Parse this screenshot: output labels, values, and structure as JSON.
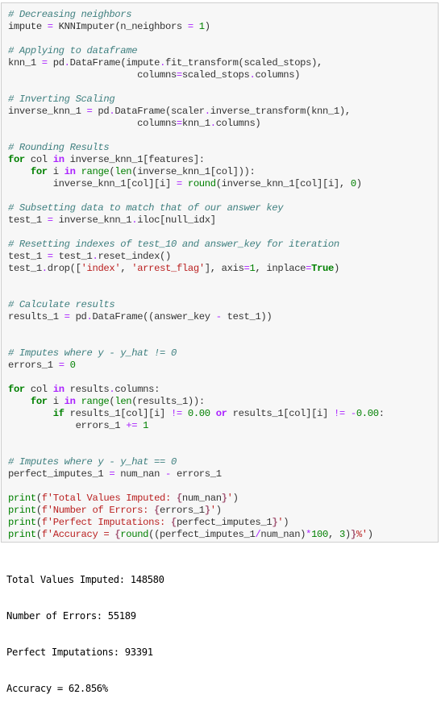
{
  "cell": {
    "lines": [
      [
        {
          "t": "c",
          "v": "# Decreasing neighbors"
        }
      ],
      [
        {
          "t": "n",
          "v": "impute "
        },
        {
          "t": "o",
          "v": "="
        },
        {
          "t": "n",
          "v": " KNNImputer(n_neighbors "
        },
        {
          "t": "o",
          "v": "="
        },
        {
          "t": "n",
          "v": " "
        },
        {
          "t": "m",
          "v": "1"
        },
        {
          "t": "n",
          "v": ")"
        }
      ],
      [],
      [
        {
          "t": "c",
          "v": "# Applying to dataframe"
        }
      ],
      [
        {
          "t": "n",
          "v": "knn_1 "
        },
        {
          "t": "o",
          "v": "="
        },
        {
          "t": "n",
          "v": " pd"
        },
        {
          "t": "o",
          "v": "."
        },
        {
          "t": "n",
          "v": "DataFrame(impute"
        },
        {
          "t": "o",
          "v": "."
        },
        {
          "t": "n",
          "v": "fit_transform(scaled_stops),"
        }
      ],
      [
        {
          "t": "n",
          "v": "                       columns"
        },
        {
          "t": "o",
          "v": "="
        },
        {
          "t": "n",
          "v": "scaled_stops"
        },
        {
          "t": "o",
          "v": "."
        },
        {
          "t": "n",
          "v": "columns)"
        }
      ],
      [],
      [
        {
          "t": "c",
          "v": "# Inverting Scaling"
        }
      ],
      [
        {
          "t": "n",
          "v": "inverse_knn_1 "
        },
        {
          "t": "o",
          "v": "="
        },
        {
          "t": "n",
          "v": " pd"
        },
        {
          "t": "o",
          "v": "."
        },
        {
          "t": "n",
          "v": "DataFrame(scaler"
        },
        {
          "t": "o",
          "v": "."
        },
        {
          "t": "n",
          "v": "inverse_transform(knn_1),"
        }
      ],
      [
        {
          "t": "n",
          "v": "                       columns"
        },
        {
          "t": "o",
          "v": "="
        },
        {
          "t": "n",
          "v": "knn_1"
        },
        {
          "t": "o",
          "v": "."
        },
        {
          "t": "n",
          "v": "columns)"
        }
      ],
      [],
      [
        {
          "t": "c",
          "v": "# Rounding Results"
        }
      ],
      [
        {
          "t": "k",
          "v": "for"
        },
        {
          "t": "n",
          "v": " col "
        },
        {
          "t": "ow",
          "v": "in"
        },
        {
          "t": "n",
          "v": " inverse_knn_1[features]:"
        }
      ],
      [
        {
          "t": "n",
          "v": "    "
        },
        {
          "t": "k",
          "v": "for"
        },
        {
          "t": "n",
          "v": " i "
        },
        {
          "t": "ow",
          "v": "in"
        },
        {
          "t": "n",
          "v": " "
        },
        {
          "t": "b",
          "v": "range"
        },
        {
          "t": "n",
          "v": "("
        },
        {
          "t": "b",
          "v": "len"
        },
        {
          "t": "n",
          "v": "(inverse_knn_1[col])):"
        }
      ],
      [
        {
          "t": "n",
          "v": "        inverse_knn_1[col][i] "
        },
        {
          "t": "o",
          "v": "="
        },
        {
          "t": "n",
          "v": " "
        },
        {
          "t": "b",
          "v": "round"
        },
        {
          "t": "n",
          "v": "(inverse_knn_1[col][i], "
        },
        {
          "t": "m",
          "v": "0"
        },
        {
          "t": "n",
          "v": ")"
        }
      ],
      [],
      [
        {
          "t": "c",
          "v": "# Subsetting data to match that of our answer key"
        }
      ],
      [
        {
          "t": "n",
          "v": "test_1 "
        },
        {
          "t": "o",
          "v": "="
        },
        {
          "t": "n",
          "v": " inverse_knn_1"
        },
        {
          "t": "o",
          "v": "."
        },
        {
          "t": "n",
          "v": "iloc[null_idx]"
        }
      ],
      [],
      [
        {
          "t": "c",
          "v": "# Resetting indexes of test_10 and answer_key for iteration"
        }
      ],
      [
        {
          "t": "n",
          "v": "test_1 "
        },
        {
          "t": "o",
          "v": "="
        },
        {
          "t": "n",
          "v": " test_1"
        },
        {
          "t": "o",
          "v": "."
        },
        {
          "t": "n",
          "v": "reset_index()"
        }
      ],
      [
        {
          "t": "n",
          "v": "test_1"
        },
        {
          "t": "o",
          "v": "."
        },
        {
          "t": "n",
          "v": "drop(["
        },
        {
          "t": "s",
          "v": "'index'"
        },
        {
          "t": "n",
          "v": ", "
        },
        {
          "t": "s",
          "v": "'arrest_flag'"
        },
        {
          "t": "n",
          "v": "], axis"
        },
        {
          "t": "o",
          "v": "="
        },
        {
          "t": "m",
          "v": "1"
        },
        {
          "t": "n",
          "v": ", inplace"
        },
        {
          "t": "o",
          "v": "="
        },
        {
          "t": "kc",
          "v": "True"
        },
        {
          "t": "n",
          "v": ")"
        }
      ],
      [],
      [],
      [
        {
          "t": "c",
          "v": "# Calculate results"
        }
      ],
      [
        {
          "t": "n",
          "v": "results_1 "
        },
        {
          "t": "o",
          "v": "="
        },
        {
          "t": "n",
          "v": " pd"
        },
        {
          "t": "o",
          "v": "."
        },
        {
          "t": "n",
          "v": "DataFrame((answer_key "
        },
        {
          "t": "o",
          "v": "-"
        },
        {
          "t": "n",
          "v": " test_1))"
        }
      ],
      [],
      [],
      [
        {
          "t": "c",
          "v": "# Imputes where y - y_hat != 0"
        }
      ],
      [
        {
          "t": "n",
          "v": "errors_1 "
        },
        {
          "t": "o",
          "v": "="
        },
        {
          "t": "n",
          "v": " "
        },
        {
          "t": "m",
          "v": "0"
        }
      ],
      [],
      [
        {
          "t": "k",
          "v": "for"
        },
        {
          "t": "n",
          "v": " col "
        },
        {
          "t": "ow",
          "v": "in"
        },
        {
          "t": "n",
          "v": " results"
        },
        {
          "t": "o",
          "v": "."
        },
        {
          "t": "n",
          "v": "columns:"
        }
      ],
      [
        {
          "t": "n",
          "v": "    "
        },
        {
          "t": "k",
          "v": "for"
        },
        {
          "t": "n",
          "v": " i "
        },
        {
          "t": "ow",
          "v": "in"
        },
        {
          "t": "n",
          "v": " "
        },
        {
          "t": "b",
          "v": "range"
        },
        {
          "t": "n",
          "v": "("
        },
        {
          "t": "b",
          "v": "len"
        },
        {
          "t": "n",
          "v": "(results_1)):"
        }
      ],
      [
        {
          "t": "n",
          "v": "        "
        },
        {
          "t": "k",
          "v": "if"
        },
        {
          "t": "n",
          "v": " results_1[col][i] "
        },
        {
          "t": "o",
          "v": "!="
        },
        {
          "t": "n",
          "v": " "
        },
        {
          "t": "m",
          "v": "0.00"
        },
        {
          "t": "n",
          "v": " "
        },
        {
          "t": "ow",
          "v": "or"
        },
        {
          "t": "n",
          "v": " results_1[col][i] "
        },
        {
          "t": "o",
          "v": "!="
        },
        {
          "t": "n",
          "v": " "
        },
        {
          "t": "o",
          "v": "-"
        },
        {
          "t": "m",
          "v": "0.00"
        },
        {
          "t": "n",
          "v": ":"
        }
      ],
      [
        {
          "t": "n",
          "v": "            errors_1 "
        },
        {
          "t": "o",
          "v": "+="
        },
        {
          "t": "n",
          "v": " "
        },
        {
          "t": "m",
          "v": "1"
        }
      ],
      [],
      [],
      [
        {
          "t": "c",
          "v": "# Imputes where y - y_hat == 0"
        }
      ],
      [
        {
          "t": "n",
          "v": "perfect_imputes_1 "
        },
        {
          "t": "o",
          "v": "="
        },
        {
          "t": "n",
          "v": " num_nan "
        },
        {
          "t": "o",
          "v": "-"
        },
        {
          "t": "n",
          "v": " errors_1"
        }
      ],
      [],
      [
        {
          "t": "b",
          "v": "print"
        },
        {
          "t": "n",
          "v": "("
        },
        {
          "t": "s",
          "v": "f'Total Values Imputed: "
        },
        {
          "t": "si",
          "v": "{"
        },
        {
          "t": "n",
          "v": "num_nan"
        },
        {
          "t": "si",
          "v": "}"
        },
        {
          "t": "s",
          "v": "'"
        },
        {
          "t": "n",
          "v": ")"
        }
      ],
      [
        {
          "t": "b",
          "v": "print"
        },
        {
          "t": "n",
          "v": "("
        },
        {
          "t": "s",
          "v": "f'Number of Errors: "
        },
        {
          "t": "si",
          "v": "{"
        },
        {
          "t": "n",
          "v": "errors_1"
        },
        {
          "t": "si",
          "v": "}"
        },
        {
          "t": "s",
          "v": "'"
        },
        {
          "t": "n",
          "v": ")"
        }
      ],
      [
        {
          "t": "b",
          "v": "print"
        },
        {
          "t": "n",
          "v": "("
        },
        {
          "t": "s",
          "v": "f'Perfect Imputations: "
        },
        {
          "t": "si",
          "v": "{"
        },
        {
          "t": "n",
          "v": "perfect_imputes_1"
        },
        {
          "t": "si",
          "v": "}"
        },
        {
          "t": "s",
          "v": "'"
        },
        {
          "t": "n",
          "v": ")"
        }
      ],
      [
        {
          "t": "b",
          "v": "print"
        },
        {
          "t": "n",
          "v": "("
        },
        {
          "t": "s",
          "v": "f'Accuracy = "
        },
        {
          "t": "si",
          "v": "{"
        },
        {
          "t": "b",
          "v": "round"
        },
        {
          "t": "n",
          "v": "((perfect_imputes_1"
        },
        {
          "t": "o",
          "v": "/"
        },
        {
          "t": "n",
          "v": "num_nan)"
        },
        {
          "t": "o",
          "v": "*"
        },
        {
          "t": "m",
          "v": "100"
        },
        {
          "t": "n",
          "v": ", "
        },
        {
          "t": "m",
          "v": "3"
        },
        {
          "t": "n",
          "v": ")"
        },
        {
          "t": "si",
          "v": "}"
        },
        {
          "t": "s",
          "v": "%'"
        },
        {
          "t": "n",
          "v": ")"
        }
      ]
    ]
  },
  "output": {
    "lines": [
      "Total Values Imputed: 148580",
      "Number of Errors: 55189",
      "Perfect Imputations: 93391",
      "Accuracy = 62.856%"
    ]
  }
}
